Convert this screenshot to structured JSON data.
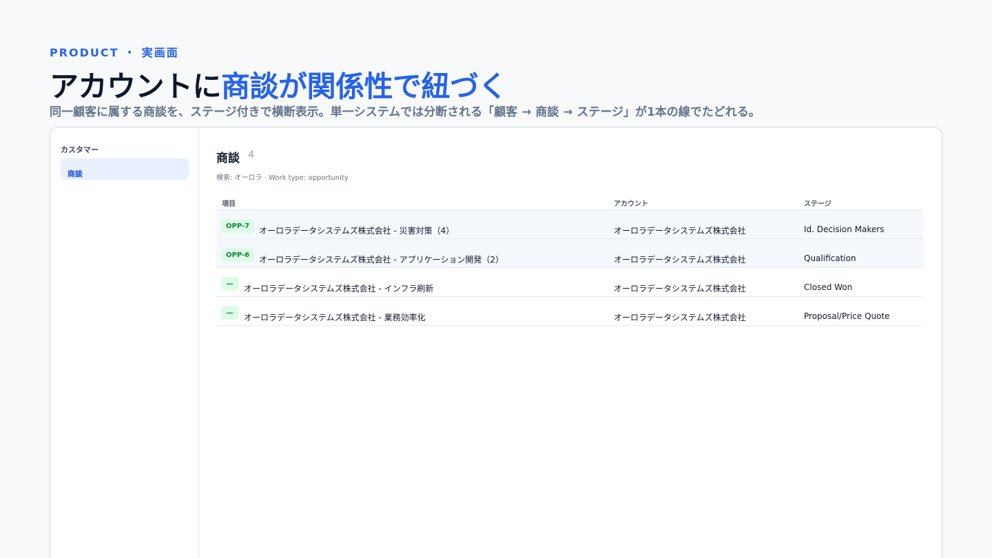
{
  "header": {
    "eyebrow": "PRODUCT ・ 実画面",
    "headline_plain": "アカウントに",
    "headline_accent": "商談が関係性で紐づく",
    "subline": "同一顧客に属する商談を、ステージ付きで横断表示。単一システムでは分断される「顧客 → 商談 → ステージ」が1本の線でたどれる。"
  },
  "sidebar": {
    "heading": "カスタマー",
    "items": [
      {
        "label": "商談",
        "active": true
      }
    ]
  },
  "main": {
    "title": "商談",
    "count": "4",
    "filter": "検索: オーロラ · Work type: opportunity",
    "table": {
      "columns": [
        "項目",
        "アカウント",
        "ステージ"
      ],
      "rows": [
        {
          "id": "OPP-7",
          "item": "オーロラデータシステムズ株式会社 - 災害対策（4）",
          "account": "オーロラデータシステムズ株式会社",
          "stage": "Id. Decision Makers"
        },
        {
          "id": "OPP-6",
          "item": "オーロラデータシステムズ株式会社 - アプリケーション開発（2）",
          "account": "オーロラデータシステムズ株式会社",
          "stage": "Qualification"
        },
        {
          "id": "—",
          "item": "オーロラデータシステムズ株式会社 - インフラ刷新",
          "account": "オーロラデータシステムズ株式会社",
          "stage": "Closed Won"
        },
        {
          "id": "—",
          "item": "オーロラデータシステムズ株式会社 - 業務効率化",
          "account": "オーロラデータシステムズ株式会社",
          "stage": "Proposal/Price Quote"
        }
      ]
    }
  },
  "colors": {
    "accent": "#2563eb",
    "badge_bg": "#dcfce7",
    "badge_text": "#15803d",
    "active_nav_bg": "#e8f0fd"
  }
}
